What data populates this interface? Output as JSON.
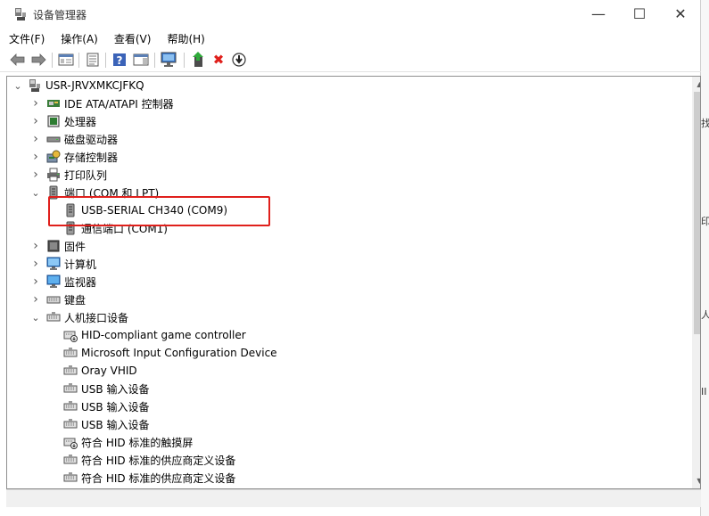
{
  "window": {
    "title": "设备管理器",
    "controls": {
      "minimize": "—",
      "maximize": "☐",
      "close": "✕"
    }
  },
  "menu": [
    "文件(F)",
    "操作(A)",
    "查看(V)",
    "帮助(H)"
  ],
  "toolbar": [
    {
      "name": "back-icon",
      "glyph": "←"
    },
    {
      "name": "forward-icon",
      "glyph": "→"
    },
    {
      "name": "show-hide-console-tree-icon"
    },
    {
      "name": "properties-icon"
    },
    {
      "name": "help-icon",
      "glyph": "?"
    },
    {
      "name": "action-pane-icon"
    },
    {
      "name": "scan-hardware-icon"
    },
    {
      "name": "update-driver-icon"
    },
    {
      "name": "uninstall-device-icon",
      "glyph": "✖"
    },
    {
      "name": "disable-device-icon",
      "glyph": "⬇"
    }
  ],
  "tree": {
    "root": "USR-JRVXMKCJFKQ",
    "nodes": [
      {
        "label": "IDE ATA/ATAPI 控制器",
        "icon": "ide-controller-icon",
        "level": 1,
        "expander": "collapsed"
      },
      {
        "label": "处理器",
        "icon": "processor-icon",
        "level": 1,
        "expander": "collapsed"
      },
      {
        "label": "磁盘驱动器",
        "icon": "disk-drive-icon",
        "level": 1,
        "expander": "collapsed"
      },
      {
        "label": "存储控制器",
        "icon": "storage-controller-icon",
        "level": 1,
        "expander": "collapsed"
      },
      {
        "label": "打印队列",
        "icon": "printer-icon",
        "level": 1,
        "expander": "collapsed"
      },
      {
        "label": "端口 (COM 和 LPT)",
        "icon": "port-icon",
        "level": 1,
        "expander": "expanded"
      },
      {
        "label": "USB-SERIAL CH340 (COM9)",
        "icon": "port-icon",
        "level": 2,
        "expander": "none"
      },
      {
        "label": "通信端口 (COM1)",
        "icon": "port-icon",
        "level": 2,
        "expander": "none"
      },
      {
        "label": "固件",
        "icon": "firmware-icon",
        "level": 1,
        "expander": "collapsed"
      },
      {
        "label": "计算机",
        "icon": "computer-icon",
        "level": 1,
        "expander": "collapsed"
      },
      {
        "label": "监视器",
        "icon": "monitor-icon",
        "level": 1,
        "expander": "collapsed"
      },
      {
        "label": "键盘",
        "icon": "keyboard-icon",
        "level": 1,
        "expander": "collapsed"
      },
      {
        "label": "人机接口设备",
        "icon": "hid-icon",
        "level": 1,
        "expander": "expanded"
      },
      {
        "label": "HID-compliant game controller",
        "icon": "hid-game-icon",
        "level": 2,
        "expander": "none"
      },
      {
        "label": "Microsoft Input Configuration Device",
        "icon": "hid-icon",
        "level": 2,
        "expander": "none"
      },
      {
        "label": "Oray VHID",
        "icon": "hid-icon",
        "level": 2,
        "expander": "none"
      },
      {
        "label": "USB 输入设备",
        "icon": "hid-icon",
        "level": 2,
        "expander": "none"
      },
      {
        "label": "USB 输入设备",
        "icon": "hid-icon",
        "level": 2,
        "expander": "none"
      },
      {
        "label": "USB 输入设备",
        "icon": "hid-icon",
        "level": 2,
        "expander": "none"
      },
      {
        "label": "符合 HID 标准的触摸屏",
        "icon": "hid-game-icon",
        "level": 2,
        "expander": "none"
      },
      {
        "label": "符合 HID 标准的供应商定义设备",
        "icon": "hid-icon",
        "level": 2,
        "expander": "none"
      },
      {
        "label": "符合 HID 标准的供应商定义设备",
        "icon": "hid-icon",
        "level": 2,
        "expander": "none"
      }
    ]
  },
  "background_window_chars": [
    "找",
    "印",
    "人",
    "II"
  ],
  "colors": {
    "highlight_box": "#e0201c",
    "folder_blue": "#2f7fd6"
  }
}
